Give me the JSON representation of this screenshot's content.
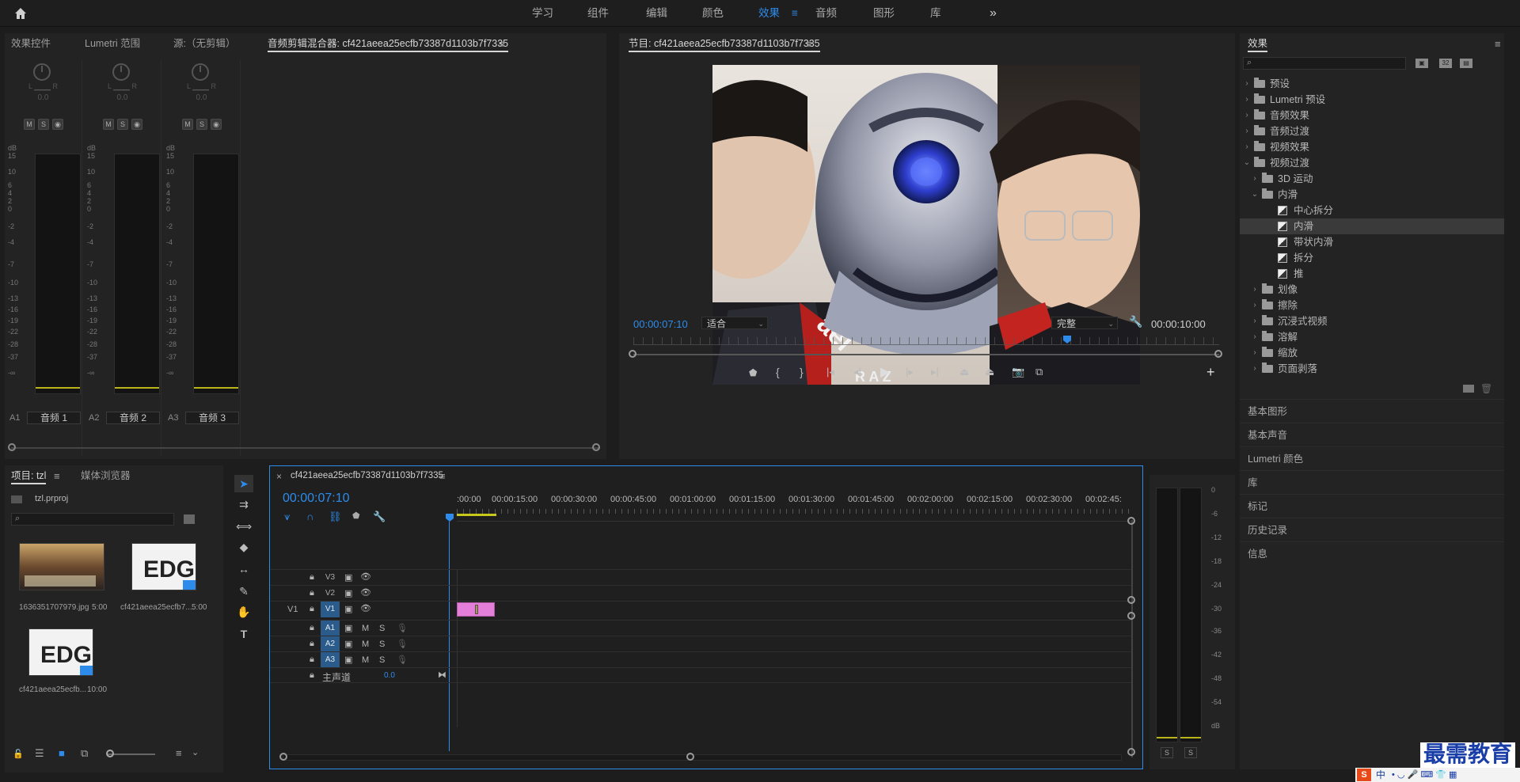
{
  "topbar": {
    "workspaces": [
      "学习",
      "组件",
      "编辑",
      "颜色",
      "效果",
      "音频",
      "图形",
      "库"
    ],
    "active_workspace": "效果",
    "more_label": "»"
  },
  "left_panel": {
    "tabs": [
      "效果控件",
      "Lumetri 范围",
      "源:（无剪辑）",
      "音频剪辑混合器: cf421aeea25ecfb73387d1103b7f7335"
    ],
    "active_tab": "音频剪辑混合器: cf421aeea25ecfb73387d1103b7f7335",
    "mixer": {
      "lr_label": "L ▁▁▁ R",
      "pan_value": "0.0",
      "m_label": "M",
      "s_label": "S",
      "db_label": "dB",
      "db_scale": [
        "15",
        "10",
        "6",
        "4",
        "2",
        "0",
        "-2",
        "-4",
        "-7",
        "-10",
        "-13",
        "-16",
        "-19",
        "-22",
        "-28",
        "-37",
        "-∞"
      ],
      "channels": [
        {
          "id": "A1",
          "name": "音频 1"
        },
        {
          "id": "A2",
          "name": "音频 2"
        },
        {
          "id": "A3",
          "name": "音频 3"
        }
      ]
    }
  },
  "program_monitor": {
    "title": "节目: cf421aeea25ecfb73387d1103b7f7335",
    "timecode_current": "00:00:07:10",
    "fit_select": "适合",
    "quality_select": "完整",
    "timecode_duration": "00:00:10:00",
    "image_caption": ""
  },
  "effects_panel": {
    "title": "效果",
    "search_placeholder": "",
    "tree": [
      {
        "label": "预设",
        "level": 0,
        "type": "folder-star",
        "expanded": false
      },
      {
        "label": "Lumetri 预设",
        "level": 0,
        "type": "folder-star",
        "expanded": false
      },
      {
        "label": "音频效果",
        "level": 0,
        "type": "folder",
        "expanded": false
      },
      {
        "label": "音频过渡",
        "level": 0,
        "type": "folder",
        "expanded": false
      },
      {
        "label": "视频效果",
        "level": 0,
        "type": "folder",
        "expanded": false
      },
      {
        "label": "视频过渡",
        "level": 0,
        "type": "folder",
        "expanded": true
      },
      {
        "label": "3D 运动",
        "level": 1,
        "type": "folder",
        "expanded": false
      },
      {
        "label": "内滑",
        "level": 1,
        "type": "folder",
        "expanded": true
      },
      {
        "label": "中心拆分",
        "level": 2,
        "type": "effect"
      },
      {
        "label": "内滑",
        "level": 2,
        "type": "effect",
        "selected": true
      },
      {
        "label": "带状内滑",
        "level": 2,
        "type": "effect"
      },
      {
        "label": "拆分",
        "level": 2,
        "type": "effect"
      },
      {
        "label": "推",
        "level": 2,
        "type": "effect"
      },
      {
        "label": "划像",
        "level": 1,
        "type": "folder",
        "expanded": false
      },
      {
        "label": "擦除",
        "level": 1,
        "type": "folder",
        "expanded": false
      },
      {
        "label": "沉浸式视频",
        "level": 1,
        "type": "folder",
        "expanded": false
      },
      {
        "label": "溶解",
        "level": 1,
        "type": "folder",
        "expanded": false
      },
      {
        "label": "缩放",
        "level": 1,
        "type": "folder",
        "expanded": false
      },
      {
        "label": "页面剥落",
        "level": 1,
        "type": "folder",
        "expanded": false
      }
    ],
    "side_panels": [
      "基本图形",
      "基本声音",
      "Lumetri 颜色",
      "库",
      "标记",
      "历史记录",
      "信息"
    ]
  },
  "project_panel": {
    "tabs": [
      "项目: tzl",
      "媒体浏览器"
    ],
    "active_tab": "项目: tzl",
    "project_file": "tzl.prproj",
    "items": [
      {
        "name": "1636351707979.jpg",
        "duration": "5:00"
      },
      {
        "name": "cf421aeea25ecfb7...",
        "duration": "5:00"
      },
      {
        "name": "cf421aeea25ecfb...",
        "duration": "10:00"
      }
    ]
  },
  "timeline": {
    "close_label": "×",
    "sequence_name": "cf421aeea25ecfb73387d1103b7f7335",
    "timecode": "00:00:07:10",
    "ruler_labels": [
      ":00:00",
      "00:00:15:00",
      "00:00:30:00",
      "00:00:45:00",
      "00:01:00:00",
      "00:01:15:00",
      "00:01:30:00",
      "00:01:45:00",
      "00:02:00:00",
      "00:02:15:00",
      "00:02:30:00",
      "00:02:45:"
    ],
    "video_tracks": [
      "V3",
      "V2",
      "V1"
    ],
    "source_patch": "V1",
    "audio_tracks": [
      "A1",
      "A2",
      "A3"
    ],
    "master_label": "主声道",
    "master_value": "0.0",
    "m_label": "M",
    "s_label": "S"
  },
  "master_meter": {
    "scale": [
      "0",
      "-6",
      "-12",
      "-18",
      "-24",
      "-30",
      "-36",
      "-42",
      "-48",
      "-54",
      "dB"
    ],
    "s_label": "S"
  },
  "watermark": {
    "text": "最需教育",
    "ime_text": "中"
  },
  "colors": {
    "accent": "#2d8ceb",
    "clip_pink": "#e37fd8",
    "track_blue": "#2b5b8a",
    "meter_yellow": "#b9b41a"
  }
}
